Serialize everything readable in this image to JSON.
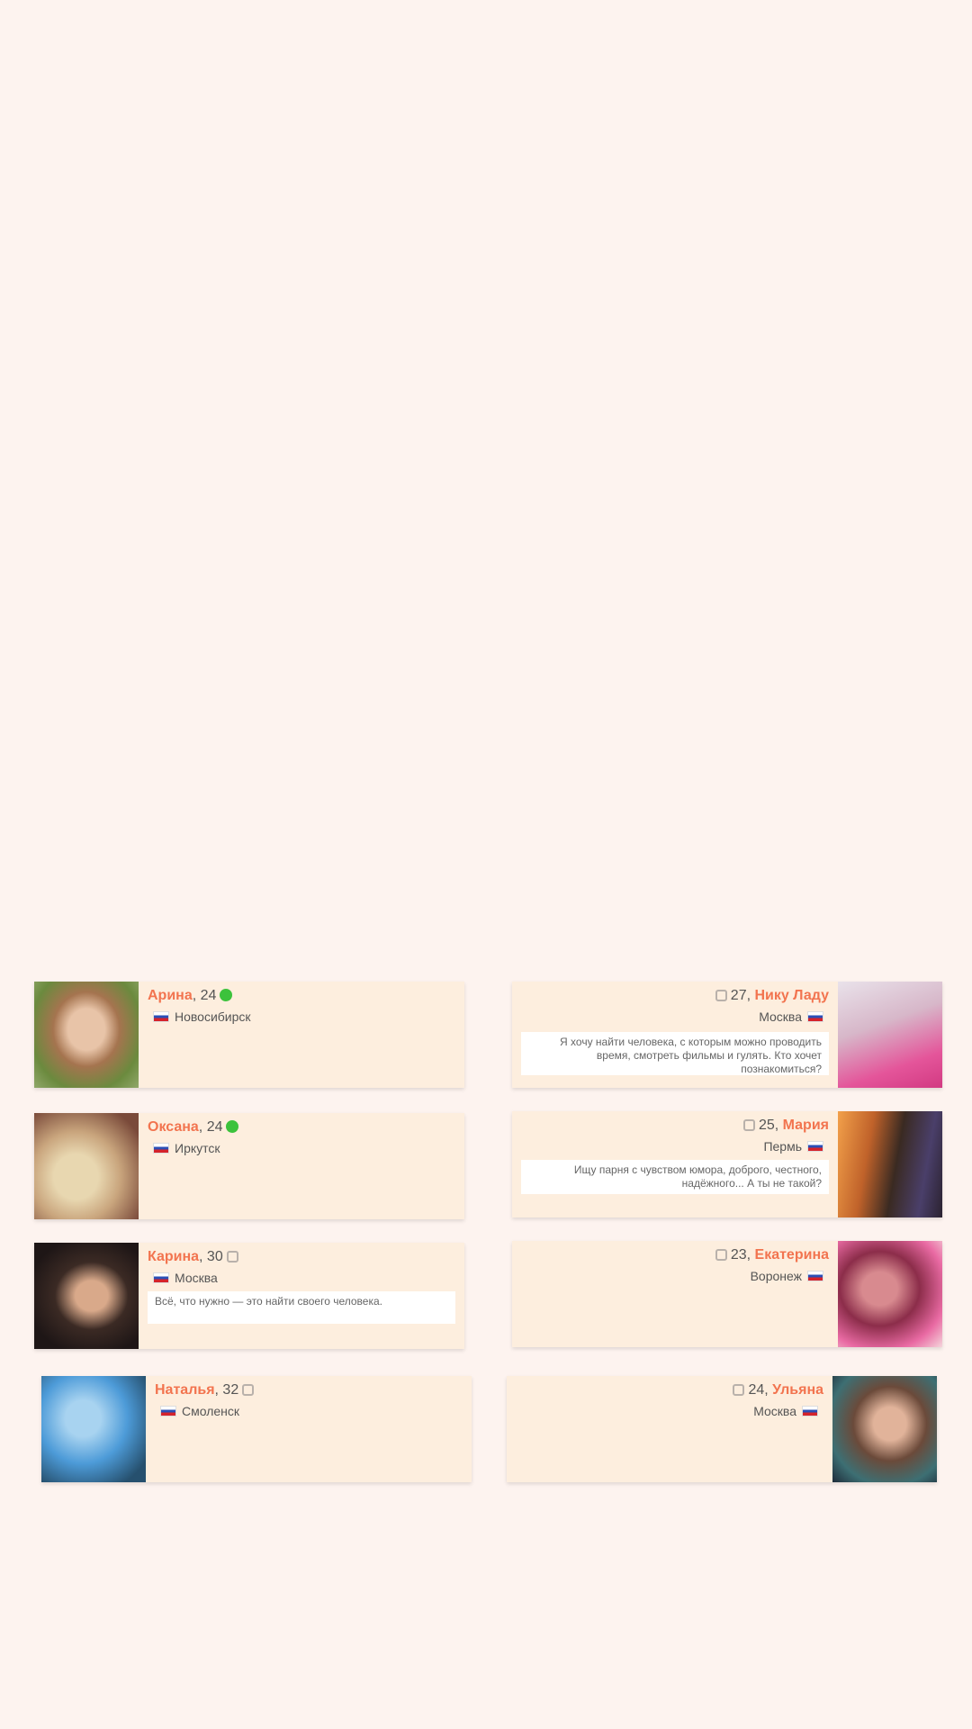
{
  "profiles": [
    {
      "name": "Арина",
      "age": "24",
      "online": true,
      "city": "Новосибирск",
      "note": ""
    },
    {
      "name": "Нику Ладу",
      "age": "27",
      "online": false,
      "city": "Москва",
      "note": "Я хочу найти человека, с которым можно проводить время, смотреть фильмы и гулять. Кто хочет познакомиться?"
    },
    {
      "name": "Оксана",
      "age": "24",
      "online": true,
      "city": "Иркутск",
      "note": ""
    },
    {
      "name": "Мария",
      "age": "25",
      "online": false,
      "city": "Пермь",
      "note": "Ищу парня с чувством юмора, доброго, честного, надёжного... А ты не такой?"
    },
    {
      "name": "Карина",
      "age": "30",
      "online": false,
      "city": "Москва",
      "note": "Всё, что нужно — это найти своего человека."
    },
    {
      "name": "Екатерина",
      "age": "23",
      "online": false,
      "city": "Воронеж",
      "note": ""
    },
    {
      "name": "Наталья",
      "age": "32",
      "online": false,
      "city": "Смоленск",
      "note": ""
    },
    {
      "name": "Ульяна",
      "age": "24",
      "online": false,
      "city": "Москва",
      "note": ""
    }
  ]
}
